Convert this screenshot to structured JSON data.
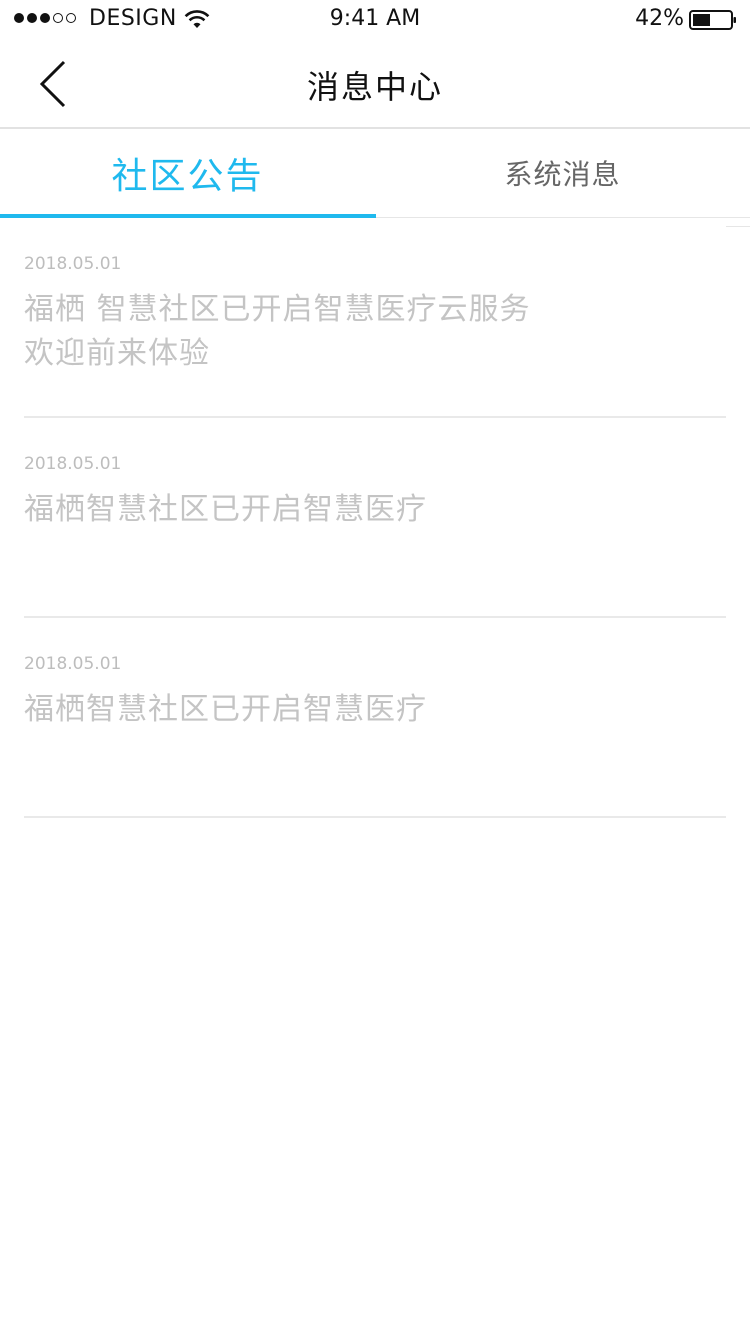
{
  "status_bar": {
    "carrier": "DESIGN",
    "time": "9:41 AM",
    "battery_pct": "42%",
    "signal_full": 3,
    "signal_total": 5
  },
  "nav": {
    "title": "消息中心",
    "back_icon": "chevron-left-icon"
  },
  "tabs": [
    {
      "label": "社区公告",
      "active": true
    },
    {
      "label": "系统消息",
      "active": false
    }
  ],
  "accent_color": "#1fb9ee",
  "messages": [
    {
      "date": "2018.05.01",
      "text": "福栖  智慧社区已开启智慧医疗云服务 欢迎前来体验"
    },
    {
      "date": "2018.05.01",
      "text": "福栖智慧社区已开启智慧医疗"
    },
    {
      "date": "2018.05.01",
      "text": "福栖智慧社区已开启智慧医疗"
    }
  ]
}
